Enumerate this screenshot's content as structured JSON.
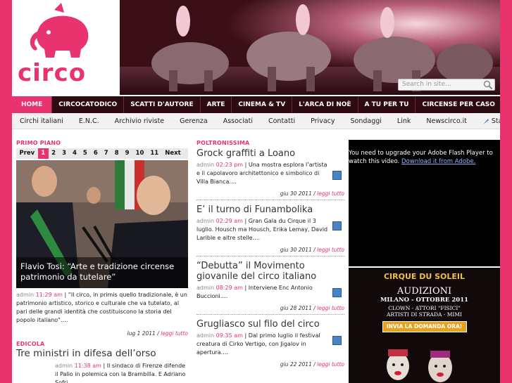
{
  "logo": {
    "text": "circo"
  },
  "search": {
    "placeholder": "Search in site..."
  },
  "nav": [
    "HOME",
    "CIRCOCATODICO",
    "SCATTI D'AUTORE",
    "ARTE",
    "CINEMA & TV",
    "L'ARCA DI NOÈ",
    "A TU PER TU",
    "CIRCENSE PER CASO"
  ],
  "subnav": [
    "Circhi italiani",
    "E.N.C.",
    "Archivio riviste",
    "Gerenza",
    "Associati",
    "Contatti",
    "Privacy",
    "Sondaggi",
    "Link",
    "Newscirco.it",
    "Stay Connected"
  ],
  "primo_piano": {
    "section": "PRIMO PIANO",
    "pager": [
      "Prev",
      "1",
      "2",
      "3",
      "4",
      "5",
      "6",
      "7",
      "8",
      "9",
      "10",
      "11",
      "Next"
    ],
    "caption": "Flavio Tosi: “Arte e tradizione circense patrimonio da tutelare”",
    "author": "admin",
    "time": "11:29 am",
    "text": "“Il circo, in primis quello tradizionale, è un patrimonio artistico, storico e culturale che va tutelato, al pari delle grandi identità che costituiscono la storia del popolo italiano”.…",
    "date": "lug 1 2011",
    "read": "leggi tutto"
  },
  "edicola": {
    "section": "EDICOLA",
    "title": "Tre ministri in difesa dell’orso",
    "author": "admin",
    "time": "11:38 am",
    "text": "Il sindaco di Firenze difende il Palio in polemica con la Brambilla. E Adriano Sofri…"
  },
  "poltronissima": {
    "section": "POLTRONISSIMA",
    "articles": [
      {
        "title": "Grock graffiti a Loano",
        "author": "admin",
        "time": "02:23 pm",
        "text": "Una mostra esplora l’artista e il capolavoro architettonico e simbolico di Villa Bianca.…",
        "date": "giu 30 2011",
        "read": "leggi tutto"
      },
      {
        "title": "E’ il turno di Funambolika",
        "author": "admin",
        "time": "02:29 am",
        "text": "Gran Gala du Cirque il 3 luglio. Housch ma Housch, Erika Lemay, David Larible e altre stelle.…",
        "date": "giu 30 2011",
        "read": "leggi tutto"
      },
      {
        "title": "“Debutta” il Movimento giovanile del circo italiano",
        "author": "admin",
        "time": "08:29 am",
        "text": "Interviene Enc Antonio Buccioni.…",
        "date": "giu 28 2011",
        "read": "leggi tutto"
      },
      {
        "title": "Grugliasco sul filo del circo",
        "author": "admin",
        "time": "09:35 am",
        "text": "Dal primo luglio il festival creatura di Cirko Vertigo, con Jigalov in apertura.…",
        "date": "giu 22 2011",
        "read": "leggi tutto"
      }
    ]
  },
  "flash": {
    "message": "You need to upgrade your Adobe Flash Player to watch this video.",
    "link": "Download it from Adobe."
  },
  "ad": {
    "brand": "CIRQUE DU SOLEIL",
    "title": "AUDIZIONI",
    "subtitle": "MILANO - OTTOBRE 2011",
    "roles1": "CLOWN - ATTORI \"FISICI\"",
    "roles2": "ARTISTI DI STRADA - MIMI",
    "button": "INVIA LA DOMANDA ORA!"
  }
}
